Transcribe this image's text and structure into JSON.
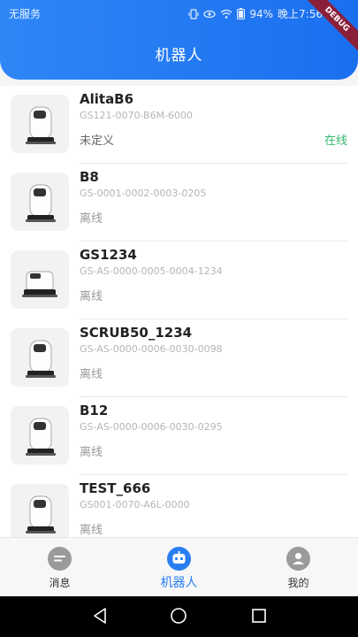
{
  "status_bar": {
    "carrier": "无服务",
    "battery": "94%",
    "time": "晚上7:56"
  },
  "header": {
    "title": "机器人",
    "debug_label": "DEBUG"
  },
  "robots": [
    {
      "name": "AlitaB6",
      "serial": "GS121-0070-B6M-6000",
      "state": "未定义",
      "online": "在线"
    },
    {
      "name": "B8",
      "serial": "GS-0001-0002-0003-0205",
      "state": "离线",
      "online": ""
    },
    {
      "name": "GS1234",
      "serial": "GS-AS-0000-0005-0004-1234",
      "state": "离线",
      "online": ""
    },
    {
      "name": "SCRUB50_1234",
      "serial": "GS-AS-0000-0006-0030-0098",
      "state": "离线",
      "online": ""
    },
    {
      "name": "B12",
      "serial": "GS-AS-0000-0006-0030-0295",
      "state": "离线",
      "online": ""
    },
    {
      "name": "TEST_666",
      "serial": "GS001-0070-A6L-0000",
      "state": "离线",
      "online": ""
    }
  ],
  "bottom_nav": {
    "tabs": [
      {
        "label": "消息",
        "icon": "message-icon",
        "active": false
      },
      {
        "label": "机器人",
        "icon": "robot-icon",
        "active": true
      },
      {
        "label": "我的",
        "icon": "profile-icon",
        "active": false
      }
    ]
  },
  "colors": {
    "accent": "#2a7ef3",
    "online": "#35b96a",
    "debug": "#8b1f3a"
  }
}
